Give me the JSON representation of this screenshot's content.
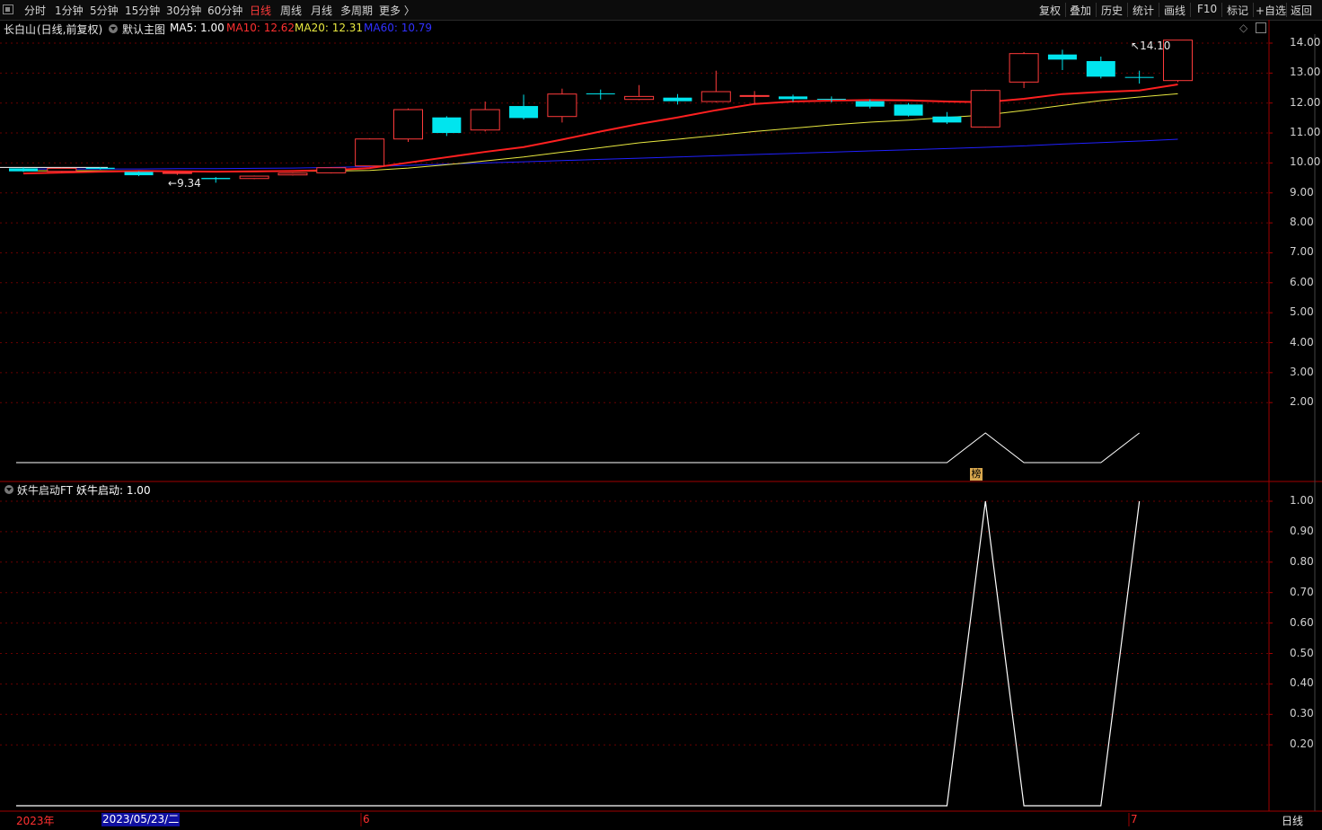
{
  "toolbar": {
    "periods": [
      "分时",
      "1分钟",
      "5分钟",
      "15分钟",
      "30分钟",
      "60分钟",
      "日线",
      "周线",
      "月线",
      "多周期",
      "更多 〉"
    ],
    "active_period": "日线",
    "actions": [
      "复权",
      "叠加",
      "历史",
      "统计",
      "画线",
      "F10",
      "标记",
      "+自选",
      "返回"
    ]
  },
  "main_header": {
    "stock": "长白山",
    "mode": "(日线,前复权)",
    "indicator_name": "默认主图",
    "ma5": "MA5: 1.00",
    "ma10": "MA10: 12.62",
    "ma20": "MA20: 12.31",
    "ma60": "MA60: 10.79"
  },
  "sub_header": {
    "indicator_name": "妖牛启动FT",
    "value": "妖牛启动: 1.00"
  },
  "price_axis": [
    "14.00",
    "13.00",
    "12.00",
    "11.00",
    "10.00",
    "9.00",
    "8.00",
    "7.00",
    "6.00",
    "5.00",
    "4.00",
    "3.00",
    "2.00"
  ],
  "sub_axis": [
    "1.00",
    "0.90",
    "0.80",
    "0.70",
    "0.60",
    "0.50",
    "0.40",
    "0.30",
    "0.20"
  ],
  "annotations": {
    "high": "14.10",
    "low": "9.34",
    "bang_badge": "榜"
  },
  "bottom_bar": {
    "year": "2023年",
    "cursor_date": "2023/05/23/二",
    "month_6": "6",
    "month_7": "7",
    "period": "日线"
  },
  "colors": {
    "up": "#ff3b3b",
    "down": "#00e5ee",
    "ma5": "#ffffff",
    "ma10": "#ff2020",
    "ma20": "#e8e840",
    "ma60": "#2020ff",
    "axis": "#a00000"
  },
  "chart_data": {
    "type": "candlestick",
    "candles": [
      {
        "o": 9.82,
        "c": 9.72,
        "h": 9.85,
        "l": 9.7
      },
      {
        "o": 9.72,
        "c": 9.82,
        "h": 9.84,
        "l": 9.68
      },
      {
        "o": 9.84,
        "c": 9.8,
        "h": 9.86,
        "l": 9.78
      },
      {
        "o": 9.7,
        "c": 9.59,
        "h": 9.72,
        "l": 9.56
      },
      {
        "o": 9.66,
        "c": 9.68,
        "h": 9.7,
        "l": 9.6
      },
      {
        "o": 9.5,
        "c": 9.46,
        "h": 9.53,
        "l": 9.34
      },
      {
        "o": 9.48,
        "c": 9.56,
        "h": 9.58,
        "l": 9.46
      },
      {
        "o": 9.6,
        "c": 9.66,
        "h": 9.68,
        "l": 9.58
      },
      {
        "o": 9.67,
        "c": 9.84,
        "h": 9.86,
        "l": 9.65
      },
      {
        "o": 9.9,
        "c": 10.8,
        "h": 10.82,
        "l": 9.88
      },
      {
        "o": 10.8,
        "c": 11.78,
        "h": 11.82,
        "l": 10.7
      },
      {
        "o": 11.52,
        "c": 11.0,
        "h": 11.56,
        "l": 10.9
      },
      {
        "o": 11.1,
        "c": 11.78,
        "h": 12.05,
        "l": 11.05
      },
      {
        "o": 11.9,
        "c": 11.5,
        "h": 12.28,
        "l": 11.45
      },
      {
        "o": 11.55,
        "c": 12.3,
        "h": 12.48,
        "l": 11.35
      },
      {
        "o": 12.32,
        "c": 12.3,
        "h": 12.45,
        "l": 12.12
      },
      {
        "o": 12.12,
        "c": 12.22,
        "h": 12.6,
        "l": 12.1
      },
      {
        "o": 12.18,
        "c": 12.06,
        "h": 12.3,
        "l": 11.95
      },
      {
        "o": 12.05,
        "c": 12.38,
        "h": 13.08,
        "l": 12.02
      },
      {
        "o": 12.22,
        "c": 12.25,
        "h": 12.4,
        "l": 11.95
      },
      {
        "o": 12.22,
        "c": 12.13,
        "h": 12.28,
        "l": 12.05
      },
      {
        "o": 12.14,
        "c": 12.12,
        "h": 12.22,
        "l": 12.02
      },
      {
        "o": 12.06,
        "c": 11.88,
        "h": 12.12,
        "l": 11.82
      },
      {
        "o": 11.95,
        "c": 11.58,
        "h": 12.0,
        "l": 11.55
      },
      {
        "o": 11.55,
        "c": 11.35,
        "h": 11.7,
        "l": 11.3
      },
      {
        "o": 11.2,
        "c": 12.42,
        "h": 12.45,
        "l": 11.18
      },
      {
        "o": 12.7,
        "c": 13.65,
        "h": 13.7,
        "l": 12.5
      },
      {
        "o": 13.62,
        "c": 13.45,
        "h": 13.78,
        "l": 13.1
      },
      {
        "o": 13.4,
        "c": 12.88,
        "h": 13.55,
        "l": 12.82
      },
      {
        "o": 12.87,
        "c": 12.85,
        "h": 13.08,
        "l": 12.65
      },
      {
        "o": 12.75,
        "c": 14.1,
        "h": 14.1,
        "l": 12.7
      }
    ],
    "ma10": [
      9.65,
      9.68,
      9.71,
      9.73,
      9.72,
      9.71,
      9.72,
      9.73,
      9.76,
      9.83,
      10.01,
      10.19,
      10.37,
      10.53,
      10.78,
      11.05,
      11.3,
      11.52,
      11.76,
      11.97,
      12.05,
      12.08,
      12.1,
      12.09,
      12.05,
      12.03,
      12.14,
      12.3,
      12.37,
      12.42,
      12.62
    ],
    "ma20": [
      9.74,
      9.74,
      9.74,
      9.73,
      9.72,
      9.71,
      9.71,
      9.72,
      9.73,
      9.75,
      9.83,
      9.94,
      10.07,
      10.2,
      10.36,
      10.51,
      10.67,
      10.79,
      10.92,
      11.05,
      11.16,
      11.27,
      11.36,
      11.43,
      11.52,
      11.6,
      11.75,
      11.92,
      12.08,
      12.2,
      12.31
    ],
    "ma60": [
      9.8,
      9.8,
      9.8,
      9.8,
      9.81,
      9.81,
      9.82,
      9.83,
      9.85,
      9.88,
      9.92,
      9.96,
      10.0,
      10.04,
      10.08,
      10.12,
      10.16,
      10.2,
      10.24,
      10.28,
      10.32,
      10.36,
      10.4,
      10.44,
      10.48,
      10.52,
      10.57,
      10.63,
      10.68,
      10.73,
      10.79
    ],
    "signal": [
      0,
      0,
      0,
      0,
      0,
      0,
      0,
      0,
      0,
      0,
      0,
      0,
      0,
      0,
      0,
      0,
      0,
      0,
      0,
      0,
      0,
      0,
      0,
      0,
      0,
      1,
      0,
      0,
      0,
      1
    ],
    "y_range": [
      0,
      14.9
    ],
    "sub_range": [
      0,
      1.1
    ]
  }
}
